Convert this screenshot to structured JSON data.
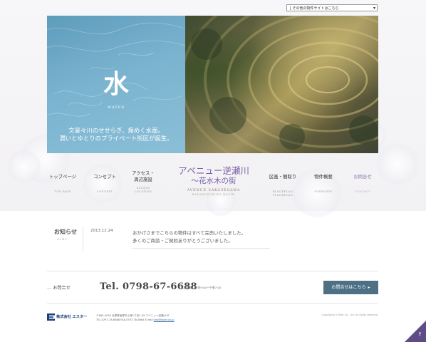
{
  "site_select": {
    "label": "[ その他の物件サイトはこちら",
    "arrow": "▾"
  },
  "hero": {
    "kanji": "水",
    "kanji_en": "WATER",
    "catch_line1": "文豪々川のせせらぎ、煌めく水面。",
    "catch_line2": "潤いとゆとりのプライベート街区が誕生。"
  },
  "nav": [
    {
      "jp": "トップページ",
      "en": "TOP PAGE"
    },
    {
      "jp": "コンセプト",
      "en": "CONCEPT"
    },
    {
      "jp1": "アクセス・",
      "jp2": "周辺施設",
      "en1": "ACCESS",
      "en2": "LOCATION"
    },
    {
      "jp": "区画・間取り",
      "en1": "BLOCKPLAN",
      "en2": "FLOORPLAN"
    },
    {
      "jp": "物件概要",
      "en": "OVERVIEW"
    },
    {
      "jp": "お問合せ",
      "en": "CONTACT"
    }
  ],
  "logo": {
    "line1": "アベニュー逆瀬川",
    "line2": "〜花水木の街",
    "en1": "AVENUE SAKASEGAWA",
    "en2": "HANAMIZUKINO MACHI"
  },
  "news": {
    "title": "お知らせ",
    "subtitle": "NEWS",
    "date": "2013.12.24",
    "line1": "おかげさまでこちらの物件はすべて完売いたしました。",
    "line2": "多くのご商談・ご契約ありがとうございました。"
  },
  "contact": {
    "label": "お問合せ",
    "tel": "Tel. 0798-67-6688",
    "hours": "営業時間：午前9:00〜午後7:00",
    "button": "お問合せはこちら",
    "button_arrow": "▸"
  },
  "footer": {
    "company": "株式会社 エスター",
    "address_line1": "〒665-0034 兵庫県宝塚市小林1丁目1-39 アベニュー逆瀬川3F",
    "address_line2": "TEL.0797-78-6688 FAX.0797-78-6665 E-Mail:",
    "email": "info@ester.co.jp",
    "copyright": "Copyright(C) Ester Co., Ltd. All rights reserved."
  },
  "colors": {
    "accent_purple": "#7b5fa5",
    "button_blue": "#4e7085",
    "pagetop": "#5f4b86"
  },
  "icons": {
    "pagetop": "arrow-up-icon",
    "company_logo": "company-logo-icon"
  }
}
